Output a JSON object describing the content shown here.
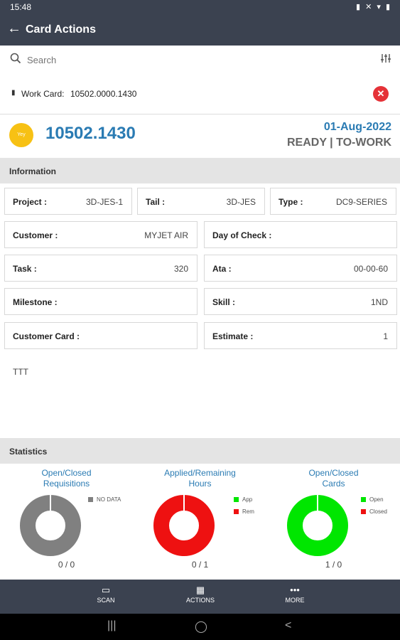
{
  "status_bar": {
    "time": "15:48",
    "icons": "▮ ✕ ▾ ▮"
  },
  "app_bar": {
    "title": "Card Actions"
  },
  "search": {
    "placeholder": "Search"
  },
  "work_card": {
    "label": "Work Card:",
    "value": "10502.0000.1430"
  },
  "card": {
    "avatar_text": "Yey",
    "number": "10502.1430",
    "date": "01-Aug-2022",
    "status": "READY | TO-WORK"
  },
  "information": {
    "title": "Information",
    "project_label": "Project :",
    "project_value": "3D-JES-1",
    "tail_label": "Tail :",
    "tail_value": "3D-JES",
    "type_label": "Type :",
    "type_value": "DC9-SERIES",
    "customer_label": "Customer :",
    "customer_value": "MYJET AIR",
    "day_of_check_label": "Day of Check :",
    "day_of_check_value": "",
    "task_label": "Task :",
    "task_value": "320",
    "ata_label": "Ata :",
    "ata_value": "00-00-60",
    "milestone_label": "Milestone :",
    "milestone_value": "",
    "skill_label": "Skill :",
    "skill_value": "1ND",
    "customer_card_label": "Customer Card :",
    "customer_card_value": "",
    "estimate_label": "Estimate :",
    "estimate_value": "1",
    "notes": "TTT"
  },
  "statistics": {
    "title": "Statistics",
    "requisitions": {
      "title_line1": "Open/Closed",
      "title_line2": "Requisitions",
      "legend": [
        "NO DATA"
      ],
      "count": "0 / 0",
      "colors": [
        "#808080"
      ]
    },
    "hours": {
      "title_line1": "Applied/Remaining",
      "title_line2": "Hours",
      "legend": [
        "App",
        "Rem"
      ],
      "count": "0 / 1",
      "colors": [
        "#00e600",
        "#ee1111"
      ]
    },
    "cards": {
      "title_line1": "Open/Closed",
      "title_line2": "Cards",
      "legend": [
        "Open",
        "Closed"
      ],
      "count": "1 / 0",
      "colors": [
        "#00e600",
        "#ee1111"
      ]
    }
  },
  "bottom_nav": {
    "scan": "SCAN",
    "actions": "ACTIONS",
    "more": "MORE"
  },
  "system_nav": {
    "recents": "|||",
    "home": "◯",
    "back": "<"
  }
}
